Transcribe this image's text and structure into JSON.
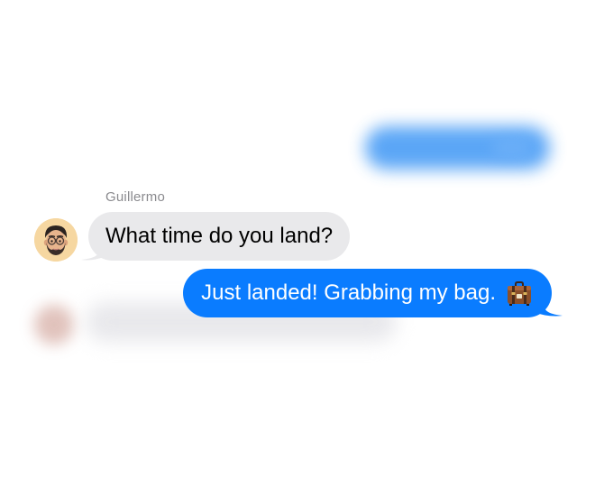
{
  "conversation": {
    "incoming": {
      "sender_name": "Guillermo",
      "text": "What time do you land?",
      "avatar": "memoji-avatar-icon"
    },
    "outgoing": {
      "text": "Just landed! Grabbing my bag.",
      "emoji": "suitcase-icon"
    }
  },
  "colors": {
    "incoming_bubble": "#e9e9eb",
    "outgoing_bubble": "#0a7cff",
    "sender_name": "#8a8a8e",
    "background": "#ffffff"
  }
}
